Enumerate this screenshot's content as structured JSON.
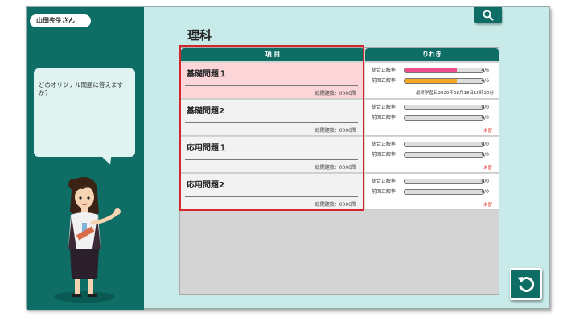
{
  "user": {
    "name": "山田先生さん"
  },
  "bubble": {
    "text": "どのオリジナル問題に答えますか？"
  },
  "subject": {
    "title": "理科"
  },
  "table": {
    "header_item": "項 目",
    "header_history": "りれき",
    "stat_total_label": "総合正解率",
    "stat_last_label": "前回正解率",
    "rows": [
      {
        "name": "基礎問題１",
        "count": "総問題数：0006問",
        "total_frac": "4/6",
        "total_rate": 0.667,
        "last_frac": "4/6",
        "last_rate": 0.667,
        "note": "最終学習日2020年08月18日15時20分"
      },
      {
        "name": "基礎問題2",
        "count": "総問題数：0006問",
        "total_frac": "0/0",
        "total_rate": 0,
        "last_frac": "0/0",
        "last_rate": 0,
        "note": "未習"
      },
      {
        "name": "応用問題１",
        "count": "総問題数：0006問",
        "total_frac": "0/0",
        "total_rate": 0,
        "last_frac": "0/0",
        "last_rate": 0,
        "note": "未習"
      },
      {
        "name": "応用問題2",
        "count": "総問題数：0006問",
        "total_frac": "0/0",
        "total_rate": 0,
        "last_frac": "0/0",
        "last_rate": 0,
        "note": "未習"
      }
    ]
  },
  "colors": {
    "accent": "#0e6e66",
    "bg": "#c8ebe9",
    "selected_row": "#fcd5d9",
    "total_bar": "#ee4f8f",
    "last_bar": "#f5a623",
    "warning": "#e03030",
    "highlight_frame": "#d2282c"
  },
  "icons": {
    "search": "search-icon",
    "back": "undo-icon"
  }
}
